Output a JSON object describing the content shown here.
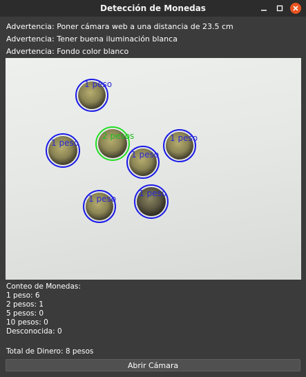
{
  "window": {
    "title": "Detección de Monedas"
  },
  "warnings": [
    "Advertencia: Poner cámara web a una distancia de 23.5 cm",
    "Advertencia: Tener buena iluminación blanca",
    "Advertencia: Fondo color blanco"
  ],
  "camera": {
    "coins": [
      {
        "label": "1 peso"
      },
      {
        "label": "2 pesos"
      },
      {
        "label": "1 peso"
      },
      {
        "label": "1 peso"
      },
      {
        "label": "1 peso"
      },
      {
        "label": "1 peso"
      },
      {
        "label": "1 peso"
      }
    ]
  },
  "counts": {
    "heading": "Conteo de Monedas:",
    "lines": [
      "1 peso: 6",
      "2 pesos: 1",
      "5 pesos: 0",
      "10 pesos: 0",
      "Desconocida: 0"
    ]
  },
  "total": "Total de Dinero: 8 pesos",
  "open_button": "Abrir Cámara",
  "colors": {
    "one_peso_circle": "#1a1ae6",
    "two_pesos_circle": "#22dd22",
    "close_button": "#e95420"
  },
  "icons": [
    "minimize-icon",
    "maximize-icon",
    "close-icon"
  ]
}
